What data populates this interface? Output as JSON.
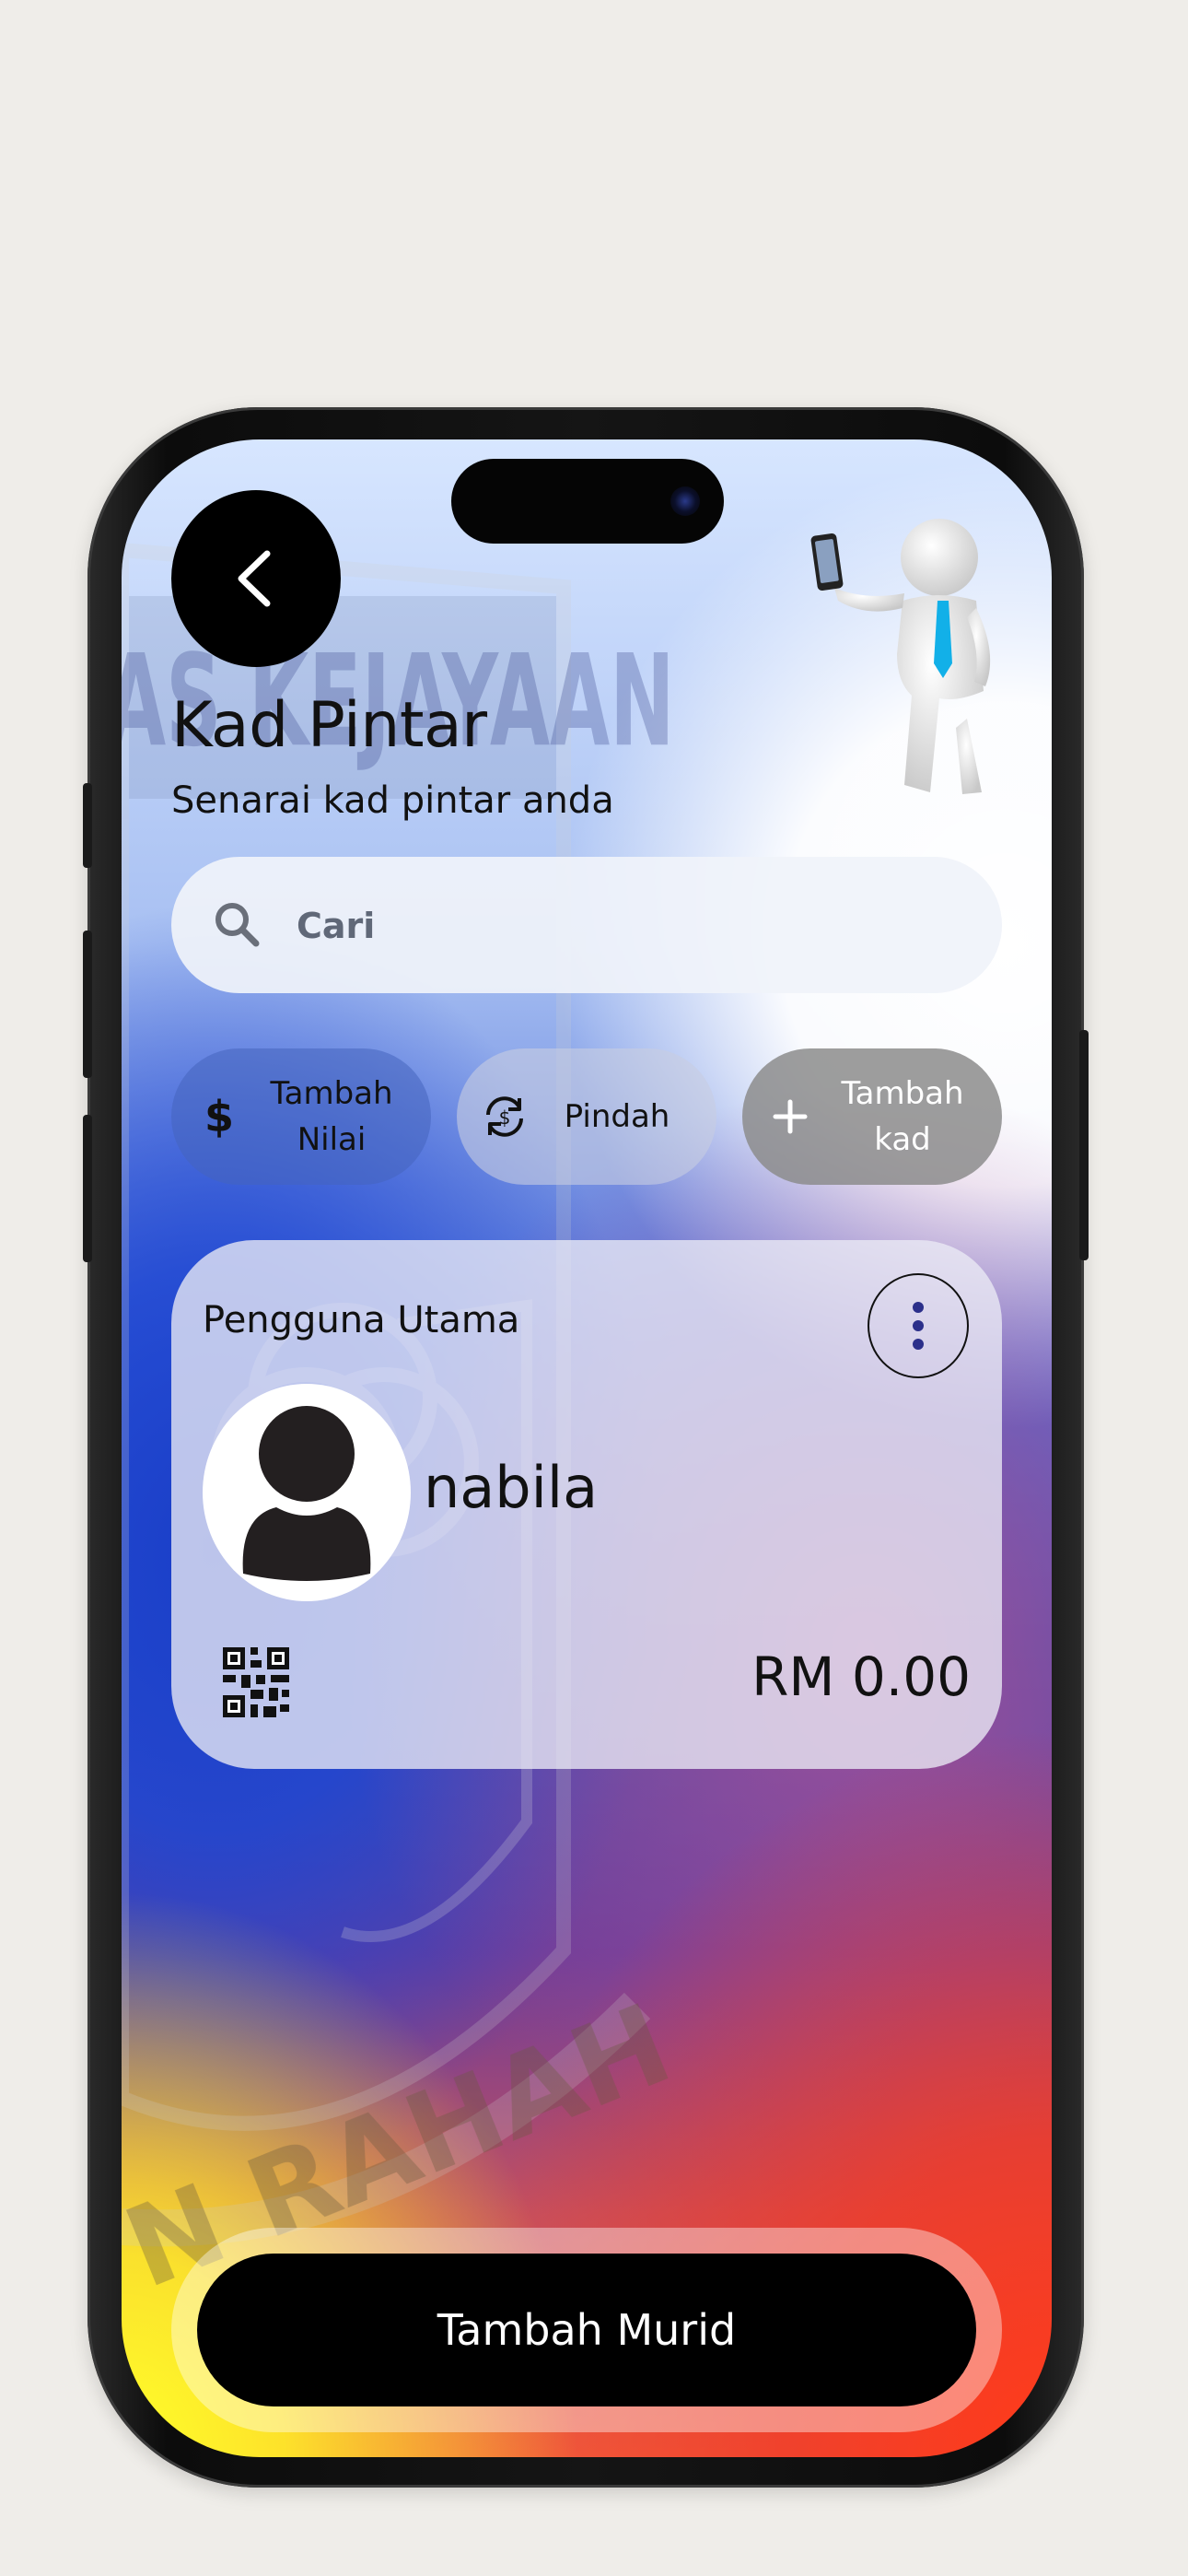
{
  "header": {
    "title": "Kad Pintar",
    "subtitle": "Senarai kad pintar anda",
    "back_icon": "chevron-left-icon"
  },
  "watermark": {
    "top_text": "AS KEJAYAAN",
    "bottom_text": "N RAHAH"
  },
  "search": {
    "placeholder": "Cari",
    "icon": "search-icon"
  },
  "actions": [
    {
      "label": "Tambah Nilai",
      "icon": "dollar-icon"
    },
    {
      "label": "Pindah",
      "icon": "transfer-icon"
    },
    {
      "label": "Tambah kad",
      "icon": "plus-icon"
    }
  ],
  "card": {
    "role": "Pengguna Utama",
    "name": "nabila",
    "balance": "RM 0.00",
    "menu_icon": "more-vertical-icon",
    "qr_icon": "qr-code-icon"
  },
  "footer": {
    "button_label": "Tambah Murid"
  },
  "colors": {
    "accent": "#000000",
    "menu_dots": "#2b2f8a",
    "search_bg": "#f0f3fa"
  }
}
